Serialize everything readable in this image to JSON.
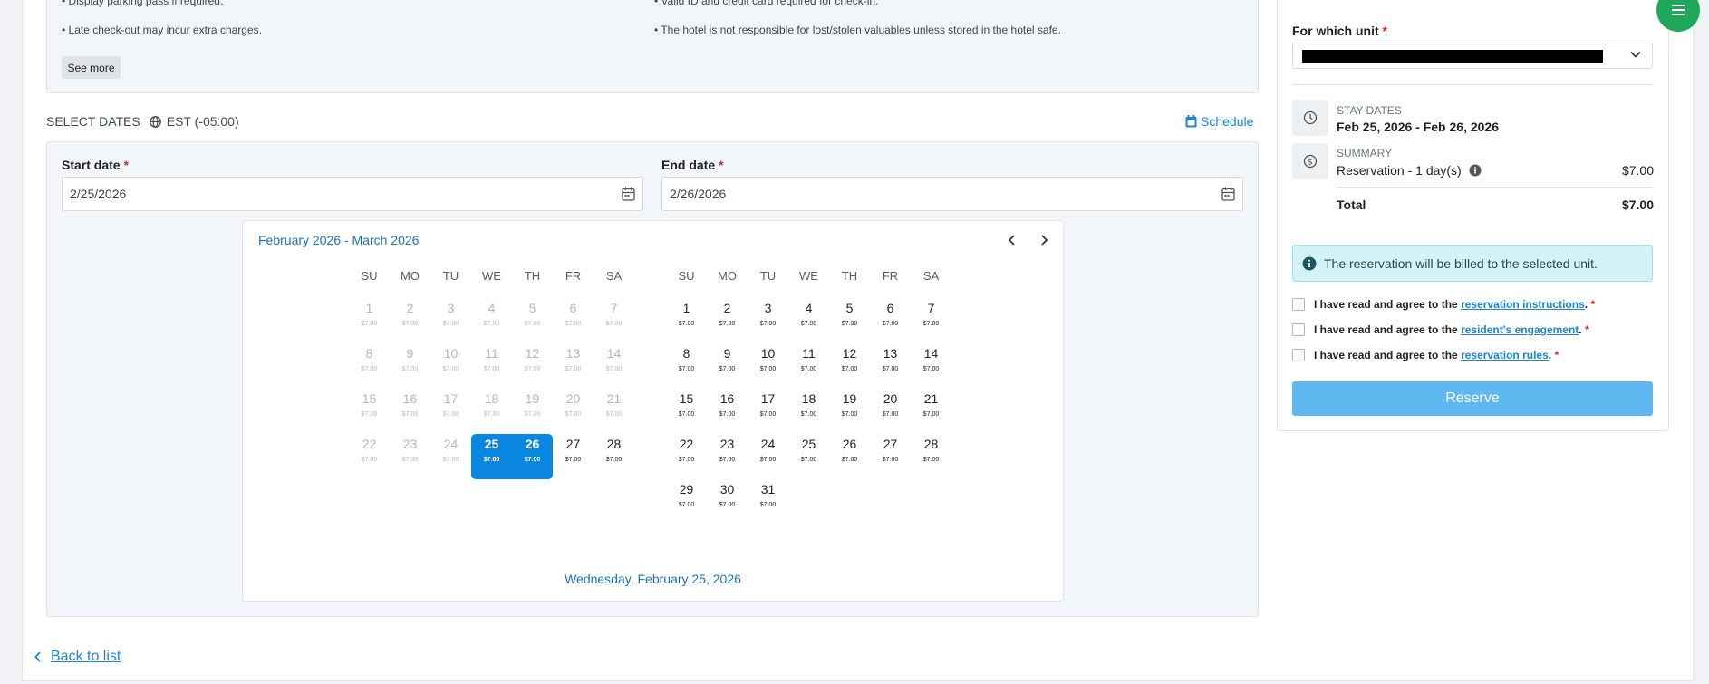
{
  "rules": {
    "left": [
      "• Display parking pass if required.",
      "• Late check-out may incur extra charges."
    ],
    "right": [
      "• Valid ID and credit card required for check-in.",
      "• The hotel is not responsible for lost/stolen valuables unless stored in the hotel safe."
    ],
    "see_more": "See more"
  },
  "select_dates": {
    "heading": "SELECT DATES",
    "timezone": "EST (-05:00)",
    "schedule": "Schedule",
    "start_label": "Start date",
    "start_value": "2/25/2026",
    "end_label": "End date",
    "end_value": "2/26/2026",
    "required_mark": "*"
  },
  "calendar": {
    "title": "February 2026 - March 2026",
    "weekdays": [
      "SU",
      "MO",
      "TU",
      "WE",
      "TH",
      "FR",
      "SA"
    ],
    "price": "$7.00",
    "footer": "Wednesday, February 25, 2026",
    "months": [
      {
        "name": "February 2026",
        "start_offset": 0,
        "days": 28,
        "disabled_before": 25,
        "selected": [
          25,
          26
        ]
      },
      {
        "name": "March 2026",
        "start_offset": 0,
        "days": 31,
        "disabled_before": 0,
        "selected": []
      }
    ]
  },
  "back_link": "Back to list",
  "side": {
    "unit_label": "For which unit",
    "required_mark": "*",
    "stay_caption": "STAY DATES",
    "stay_value": "Feb 25, 2026 - Feb 26, 2026",
    "summary_caption": "SUMMARY",
    "summary_line": "Reservation - 1 day(s)",
    "summary_amount": "$7.00",
    "total_label": "Total",
    "total_amount": "$7.00",
    "alert": "The reservation will be billed to the selected unit.",
    "agree_prefix": "I have read and agree to the",
    "agree_links": [
      "reservation instructions",
      "resident's engagement",
      "reservation rules"
    ],
    "reserve": "Reserve"
  },
  "colors": {
    "accent": "#0a87e0",
    "link": "#1b86d1",
    "reserve_button": "#60b8f0",
    "fab": "#1fa85a",
    "required": "#e02424"
  }
}
